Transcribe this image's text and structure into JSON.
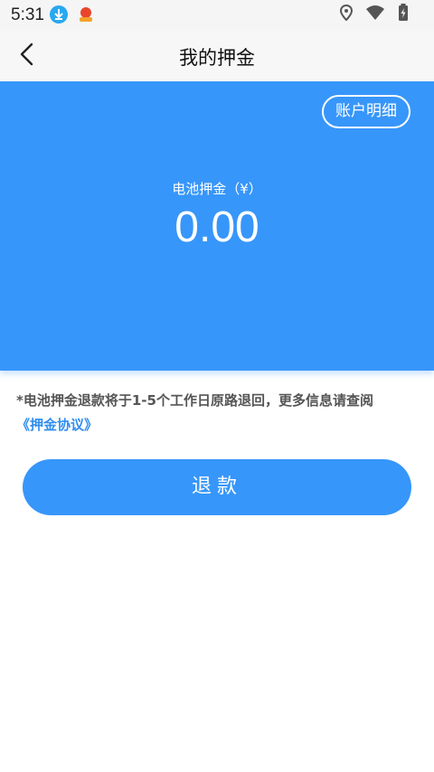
{
  "status_bar": {
    "time": "5:31",
    "icons": [
      "download-notification-icon",
      "app-notification-icon",
      "location-icon",
      "wifi-icon",
      "battery-charging-icon"
    ]
  },
  "app_bar": {
    "title": "我的押金",
    "back_icon": "chevron-left-icon"
  },
  "hero": {
    "account_detail_label": "账户明细",
    "deposit_label": "电池押金（¥）",
    "deposit_amount": "0.00",
    "background_color": "#3796fa"
  },
  "notice": {
    "text": "*电池押金退款将于1-5个工作日原路退回，更多信息请查阅",
    "link_text": "《押金协议》",
    "link_color": "#2f8ef0"
  },
  "refund_button": {
    "label": "退款"
  }
}
